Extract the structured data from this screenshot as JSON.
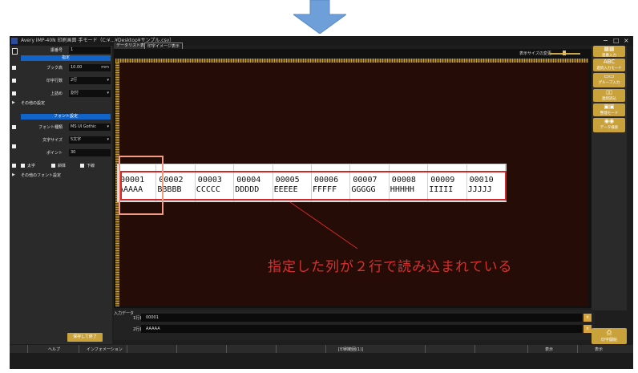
{
  "window": {
    "title": "Avery IMP-40N 印刷画面 手モード（C:¥...¥Desktop¥サンプル.csv）",
    "controls": [
      "−",
      "□",
      "×"
    ]
  },
  "left_panel": {
    "label_count_label": "振番号",
    "label_count_value": "1",
    "section_settings": "指定",
    "size_label": "ブック高",
    "size_value": "10.00",
    "size_unit": "mm",
    "print_row_label": "印字行数",
    "print_row_value": "2行",
    "align_label": "上詰め",
    "align_value": "割付",
    "other_settings": "その他の設定",
    "section_font": "フォント設定",
    "font_type_label": "フォント種類",
    "font_type_value": "MS UI Gothic",
    "char_size_label": "文字サイズ",
    "char_size_value": "5文字",
    "point_label": "ポイント",
    "point_value": "30",
    "bold_label": "太字",
    "italic_label": "斜体",
    "underline_label": "下線",
    "other_font_settings": "その他のフォント設定",
    "save_button": "保存して終了"
  },
  "tabs": [
    {
      "label": "データリスト表示"
    },
    {
      "label": "印字イメージ表示"
    }
  ],
  "zoom": {
    "label": "表示サイズの変更",
    "level": 0.6
  },
  "label_cells": [
    {
      "line1": "00001",
      "line2": "AAAAA"
    },
    {
      "line1": "00002",
      "line2": "BBBBB"
    },
    {
      "line1": "00003",
      "line2": "CCCCC"
    },
    {
      "line1": "00004",
      "line2": "DDDDD"
    },
    {
      "line1": "00005",
      "line2": "EEEEE"
    },
    {
      "line1": "00006",
      "line2": "FFFFF"
    },
    {
      "line1": "00007",
      "line2": "GGGGG"
    },
    {
      "line1": "00008",
      "line2": "HHHHH"
    },
    {
      "line1": "00009",
      "line2": "IIIII"
    },
    {
      "line1": "00010",
      "line2": "JJJJJ"
    }
  ],
  "annotation": "指定した列が２行で読み込まれている",
  "right_panel": {
    "buttons": [
      "連番入力",
      "連続入力モード",
      "グループ入力",
      "連続読込",
      "整理モード",
      "データ検索"
    ],
    "icons": [
      "grid-icon",
      "abc-icon",
      "layout-icon",
      "columns-icon",
      "abc-box-icon",
      "binoculars-icon"
    ],
    "print_button": "印字開始"
  },
  "input_area": {
    "title": "入力データ",
    "rows": [
      {
        "label": "1行目",
        "value": "00001"
      },
      {
        "label": "2行目",
        "value": "AAAAA"
      }
    ]
  },
  "status_bar": {
    "help": "ヘルプ",
    "info": "インフォメーション",
    "print_count": "[印刷範囲(1)]",
    "view1": "表示",
    "view2": "表示"
  },
  "colors": {
    "accent_gold": "#caa23c",
    "section_blue": "#1264c8",
    "highlight_red": "#d2282a",
    "highlight_salmon": "#f39a82",
    "annotation_red": "#d83030",
    "arrow_blue": "#6f9fd8"
  }
}
